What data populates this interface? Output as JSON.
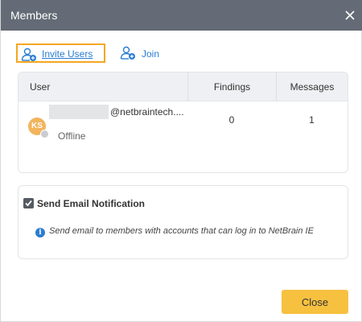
{
  "dialog": {
    "title": "Members",
    "close_icon": "close-icon"
  },
  "actions": {
    "invite_label": "Invite Users",
    "invite_icon": "invite-user-icon",
    "join_label": "Join",
    "join_icon": "join-user-icon"
  },
  "members_table": {
    "columns": [
      "User",
      "Findings",
      "Messages"
    ],
    "rows": [
      {
        "avatar_initials": "KS",
        "email": "@netbraintech....",
        "status": "Offline",
        "findings": "0",
        "messages": "1"
      }
    ]
  },
  "notification": {
    "checked": true,
    "label": "Send Email Notification",
    "info_icon": "info-icon",
    "info_text": "Send email to members with accounts that can log in to NetBrain IE"
  },
  "footer": {
    "close_label": "Close"
  },
  "colors": {
    "titlebar": "#646b76",
    "link": "#2a7dd1",
    "highlight_border": "#f5a623",
    "primary_button": "#f7c140",
    "avatar": "#f2b45c"
  }
}
